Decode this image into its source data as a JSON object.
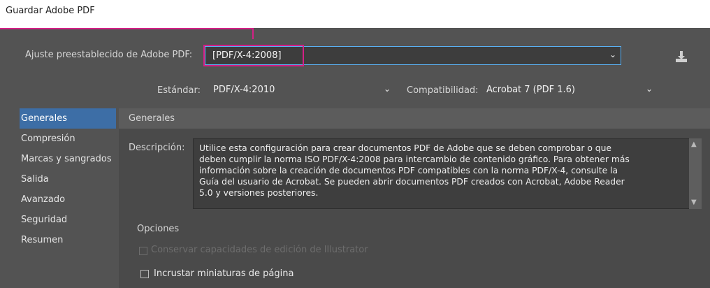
{
  "window": {
    "title": "Guardar Adobe PDF"
  },
  "preset": {
    "label": "Ajuste preestablecido de Adobe PDF:",
    "value": "[PDF/X-4:2008]"
  },
  "standard": {
    "label": "Estándar:",
    "value": "PDF/X-4:2010"
  },
  "compatibility": {
    "label": "Compatibilidad:",
    "value": "Acrobat 7 (PDF 1.6)"
  },
  "sidebar": {
    "items": [
      {
        "label": "Generales"
      },
      {
        "label": "Compresión"
      },
      {
        "label": "Marcas y sangrados"
      },
      {
        "label": "Salida"
      },
      {
        "label": "Avanzado"
      },
      {
        "label": "Seguridad"
      },
      {
        "label": "Resumen"
      }
    ]
  },
  "panel": {
    "title": "Generales",
    "description_label": "Descripción:",
    "description": "Utilice esta configuración para crear documentos PDF de Adobe que se deben comprobar o que\ndeben cumplir la norma ISO PDF/X-4:2008 para intercambio de contenido gráfico. Para obtener más\ninformación sobre la creación de documentos PDF compatibles con la norma PDF/X-4, consulte la\nGuía del usuario de Acrobat. Se pueden abrir documentos PDF creados con Acrobat, Adobe Reader\n5.0 y versiones posteriores.",
    "options_label": "Opciones",
    "options": [
      {
        "label": "Conservar capacidades de edición de Illustrator",
        "checked": false,
        "enabled": false
      },
      {
        "label": "Incrustar miniaturas de página",
        "checked": false,
        "enabled": true
      }
    ]
  },
  "colors": {
    "dialog_bg": "#535353",
    "accent": "#5ab1f3",
    "selected": "#3d6ea6",
    "callout": "#d42086"
  }
}
